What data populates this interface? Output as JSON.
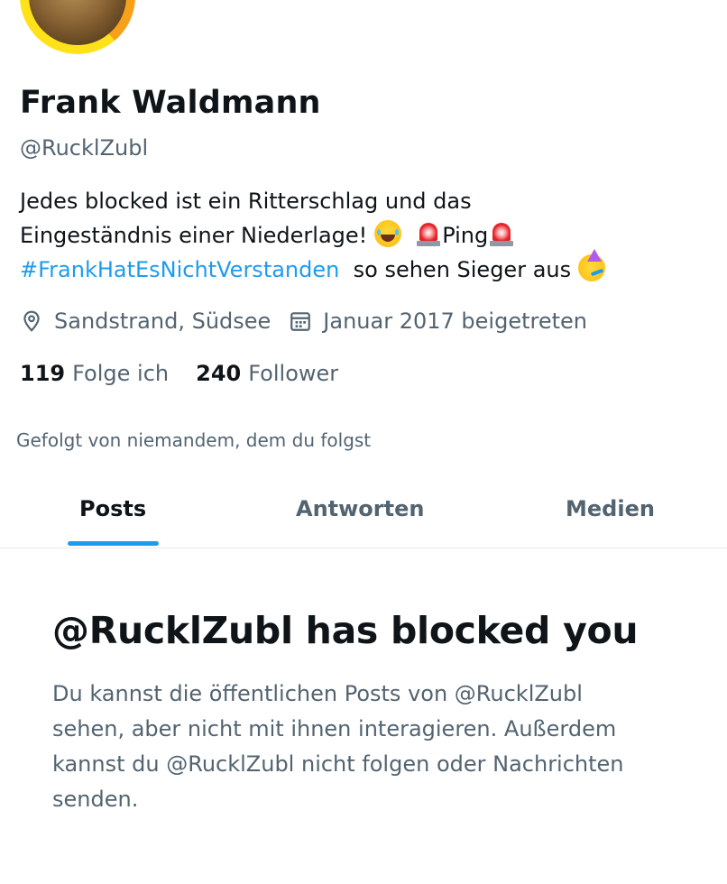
{
  "profile": {
    "display_name": "Frank Waldmann",
    "handle": "@RucklZubl",
    "bio": {
      "line1": "Jedes blocked ist ein Ritterschlag und das",
      "line2_text": "Eingeständnis einer Niederlage!",
      "line2_tail": "Ping",
      "hashtag": "#FrankHatEsNichtVerstanden",
      "line3_tail": "so sehen Sieger aus",
      "emojis": [
        "laughing-emoji",
        "siren-emoji",
        "siren-emoji",
        "party-face-emoji"
      ]
    },
    "location": "Sandstrand, Südsee",
    "joined": "Januar 2017 beigetreten",
    "following_count": "119",
    "following_label": "Folge ich",
    "followers_count": "240",
    "followers_label": "Follower",
    "followed_by": "Gefolgt von niemandem, dem du folgst"
  },
  "tabs": [
    {
      "label": "Posts",
      "active": true
    },
    {
      "label": "Antworten",
      "active": false
    },
    {
      "label": "Medien",
      "active": false
    }
  ],
  "blocked_notice": {
    "title": "@RucklZubl has blocked you",
    "lines": [
      "Du kannst die öffentlichen Posts von @RucklZubl",
      "sehen, aber nicht mit ihnen interagieren. Außerdem",
      "kannst du @RucklZubl nicht folgen oder Nachrichten",
      "senden."
    ]
  },
  "colors": {
    "accent": "#1d9bf0",
    "text_primary": "#0f1419",
    "text_secondary": "#536471"
  }
}
